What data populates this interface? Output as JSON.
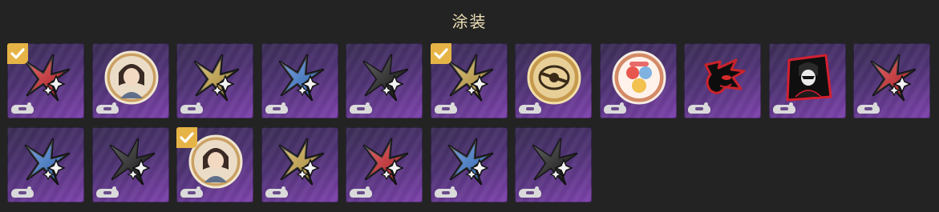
{
  "header": {
    "title": "涂装"
  },
  "theme": {
    "tile_gradient": [
      "#3b2f55",
      "#7e43ad"
    ],
    "check_color": "#e6b446"
  },
  "tiles": [
    {
      "icon": "red-star-decal-icon",
      "color": "#e0262c",
      "selected": true
    },
    {
      "icon": "character-portrait-icon",
      "selected": false
    },
    {
      "icon": "gold-star-decal-icon",
      "color": "#d9b24a",
      "selected": false
    },
    {
      "icon": "blue-star-decal-icon",
      "color": "#3f82e0",
      "selected": false
    },
    {
      "icon": "black-star-decal-icon",
      "color": "#1b1b1b",
      "selected": false
    },
    {
      "icon": "gold-star-decal-icon",
      "color": "#d9b24a",
      "selected": true
    },
    {
      "icon": "gold-emblem-badge-icon",
      "selected": false
    },
    {
      "icon": "cartoon-sticker-badge-icon",
      "selected": false
    },
    {
      "icon": "shadow-hedgehog-icon",
      "selected": false
    },
    {
      "icon": "masked-phantom-icon",
      "selected": false
    },
    {
      "icon": "red-star-decal-icon",
      "color": "#e0262c",
      "selected": false
    },
    {
      "icon": "blue-star-decal-icon",
      "color": "#3f82e0",
      "selected": false
    },
    {
      "icon": "black-star-decal-icon",
      "color": "#1b1b1b",
      "selected": false
    },
    {
      "icon": "character-portrait-icon",
      "selected": true
    },
    {
      "icon": "gold-star-decal-icon",
      "color": "#d9b24a",
      "selected": false
    },
    {
      "icon": "red-star-decal-icon",
      "color": "#e0262c",
      "selected": false
    },
    {
      "icon": "blue-star-decal-icon",
      "color": "#3f82e0",
      "selected": false
    },
    {
      "icon": "black-star-decal-icon",
      "color": "#1b1b1b",
      "selected": false
    }
  ]
}
